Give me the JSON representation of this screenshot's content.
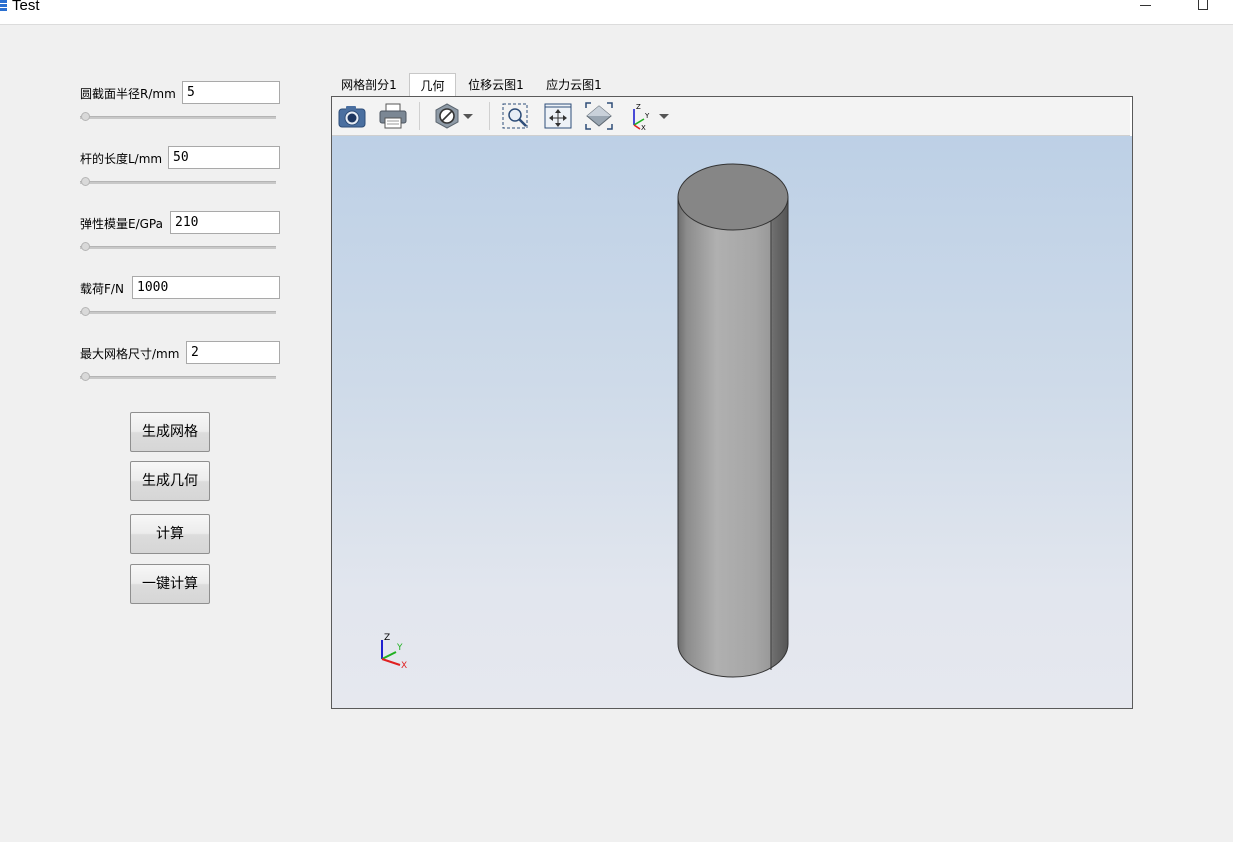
{
  "window": {
    "title": "Test",
    "icon": "app-icon"
  },
  "params": [
    {
      "label": "圆截面半径R/mm",
      "value": "5"
    },
    {
      "label": "杆的长度L/mm",
      "value": "50"
    },
    {
      "label": "弹性模量E/GPa",
      "value": "210"
    },
    {
      "label": "载荷F/N",
      "value": "1000"
    },
    {
      "label": "最大网格尺寸/mm",
      "value": "2"
    }
  ],
  "buttons": {
    "generate_mesh": "生成网格",
    "generate_geometry": "生成几何",
    "compute": "计算",
    "one_click_compute": "一键计算"
  },
  "tabs": [
    {
      "label": "网格剖分1",
      "active": false
    },
    {
      "label": "几何",
      "active": true
    },
    {
      "label": "位移云图1",
      "active": false
    },
    {
      "label": "应力云图1",
      "active": false
    }
  ],
  "toolbar": {
    "icons": [
      "camera-icon",
      "print-icon",
      "render-mode-icon",
      "zoom-box-icon",
      "pan-icon",
      "fit-view-icon",
      "axes-orientation-icon"
    ]
  },
  "viewport": {
    "axis_labels": {
      "x": "X",
      "y": "Y",
      "z": "Z"
    },
    "colors": {
      "x_axis": "#e02020",
      "y_axis": "#20b020",
      "z_axis": "#2020d0",
      "background_top": "#bdd0e6",
      "background_bottom": "#e6e8ef"
    }
  }
}
